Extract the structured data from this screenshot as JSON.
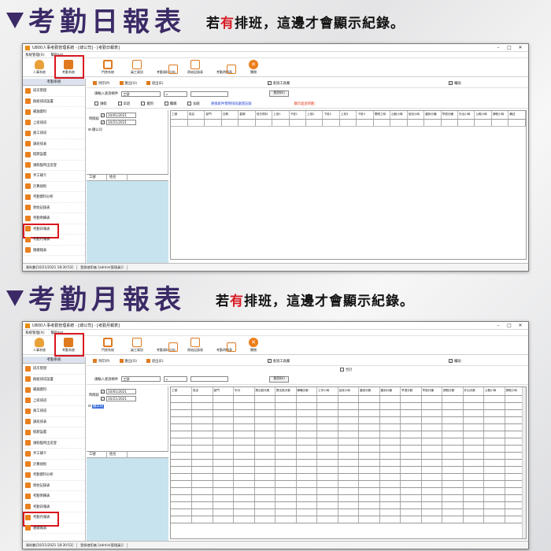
{
  "banner_daily": {
    "title": "考勤日報表",
    "note_prefix": "若",
    "note_red": "有",
    "note_suffix": "排班，這邊才會顯示紀錄。"
  },
  "banner_monthly": {
    "title": "考勤月報表",
    "note_prefix": "若",
    "note_red": "有",
    "note_suffix": "排班，這邊才會顯示紀錄。"
  },
  "colors": {
    "accent": "#3b2a66",
    "highlight": "#d9161f",
    "icon_orange": "#e07a1f",
    "panel_blue": "#c7e3ee"
  },
  "window_daily": {
    "title": "U800人事考勤管理系統 - [總公司] - [考勤日報表]",
    "menu": [
      "系統管理(X)",
      "幫助(H)"
    ],
    "toolbar": [
      {
        "label": "人事系統",
        "icon": "person-icon"
      },
      {
        "label": "考勤系統",
        "icon": "calendar-icon"
      },
      {
        "label": "門禁系統",
        "icon": "book-icon"
      },
      {
        "label": "員工資訊",
        "icon": "document-icon"
      },
      {
        "label": "考勤資料分析",
        "icon": "grid-icon"
      },
      {
        "label": "原始記錄表",
        "icon": "record-icon"
      },
      {
        "label": "考勤明細表",
        "icon": "sheet-icon"
      },
      {
        "label": "關閉",
        "icon": "exit-icon"
      }
    ],
    "subbar": [
      "列印(P)",
      "匯出(O)",
      "退出(E)"
    ],
    "show_items_label": "查詢工具欄",
    "assist_label": "輔助",
    "query_label": "請輸入查詢條件",
    "query_field": "工號",
    "query_op": "=",
    "search_button": "查詢(E)",
    "filters": [
      "請假",
      "早退",
      "遲到",
      "曠職",
      "加班"
    ],
    "note_blue": "將換班件實際排班處理記錄",
    "note_red": "顯示超過時數：",
    "date_label": "時間段",
    "date_from": "10/01/2021",
    "date_to": "10/21/2021",
    "tree_root": "總公司",
    "emp_cols": [
      "工號",
      "姓名"
    ],
    "columns": [
      "工號",
      "姓名",
      "部門",
      "日期",
      "星期",
      "班次資料",
      "上班1",
      "下班1",
      "上班2",
      "下班2",
      "上班3",
      "下班3",
      "實際工時",
      "出勤小時",
      "加班小時",
      "遲到分鐘",
      "早退分鐘",
      "外出小時",
      "公假小時",
      "請假小時",
      "備註"
    ],
    "status": [
      "資料數[10/21/2021 18:30:53]",
      "登錄使用者 [admin(管理員)]"
    ]
  },
  "window_monthly": {
    "title": "U800人事考勤管理系統 - [總公司] - [考勤月報表]",
    "menu": [
      "系統管理(X)",
      "幫助(H)"
    ],
    "toolbar": [
      {
        "label": "人事系統",
        "icon": "person-icon"
      },
      {
        "label": "考勤系統",
        "icon": "calendar-icon"
      },
      {
        "label": "門禁系統",
        "icon": "book-icon"
      },
      {
        "label": "員工資訊",
        "icon": "document-icon"
      },
      {
        "label": "考勤資料分析",
        "icon": "grid-icon"
      },
      {
        "label": "原始記錄表",
        "icon": "record-icon"
      },
      {
        "label": "考勤明細表",
        "icon": "sheet-icon"
      },
      {
        "label": "關閉",
        "icon": "exit-icon"
      }
    ],
    "subbar": [
      "列印(P)",
      "匯出(O)",
      "退出(E)"
    ],
    "show_items_label": "查詢工具欄",
    "assist_label": "輔助",
    "total_label": "合計",
    "query_label": "請輸入查詢條件",
    "query_field": "工號",
    "query_op": "=",
    "search_button": "查詢(E)",
    "date_label": "時間段",
    "date_from": "10/01/2021",
    "date_to": "10/21/2021",
    "tree_root": "總公司",
    "emp_cols": [
      "工號",
      "姓名"
    ],
    "columns": [
      "工號",
      "姓名",
      "部門",
      "年月",
      "應出勤天數",
      "實出勤天數",
      "曠職天數",
      "工作小時",
      "加班小時",
      "遲到次數",
      "遲到分鐘",
      "早退次數",
      "早退分鐘",
      "請假次數",
      "外出次數",
      "公假小時",
      "請假小時"
    ],
    "status": [
      "資料數[10/21/2021 18:30:53]",
      "登錄使用者 [admin(管理員)]"
    ]
  },
  "sidebar": {
    "head": "考勤系統",
    "items": [
      "班次管理",
      "群組排班設置",
      "補漏資料",
      "上班排班",
      "員工排班",
      "調班排表",
      "假期設置",
      "請假臨時出差登",
      "手工補卡",
      "計算規則",
      "考勤資料分析",
      "原始記錄表",
      "考勤明細表",
      "考勤日報表",
      "考勤月報表",
      "匯總報表"
    ]
  }
}
